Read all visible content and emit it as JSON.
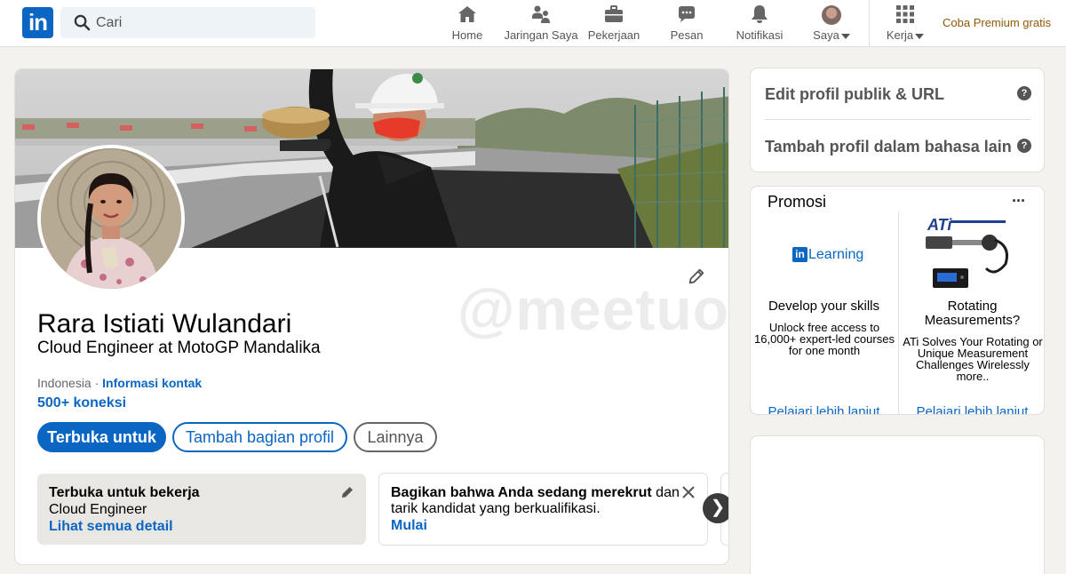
{
  "topnav": {
    "logo_text": "in",
    "search": {
      "placeholder": "Cari"
    },
    "items": [
      {
        "label": "Home",
        "icon": "home-icon"
      },
      {
        "label": "Jaringan Saya",
        "icon": "network-icon"
      },
      {
        "label": "Pekerjaan",
        "icon": "briefcase-icon"
      },
      {
        "label": "Pesan",
        "icon": "message-icon"
      },
      {
        "label": "Notifikasi",
        "icon": "bell-icon"
      },
      {
        "label": "Saya",
        "icon": "avatar"
      },
      {
        "label": "Kerja",
        "icon": "grid-icon"
      }
    ],
    "premium_label": "Coba Premium gratis"
  },
  "profile": {
    "name": "Rara Istiati Wulandari",
    "headline": "Cloud Engineer at MotoGP Mandalika",
    "location": "Indonesia",
    "separator": "·",
    "contact_link": "Informasi kontak",
    "connections": "500+ koneksi",
    "watermark": "@meetuoup",
    "buttons": {
      "open_to": "Terbuka untuk",
      "add_section": "Tambah bagian profil",
      "more": "Lainnya"
    },
    "open_to_work": {
      "title": "Terbuka untuk bekerja",
      "role": "Cloud Engineer",
      "link": "Lihat semua detail"
    },
    "share_hiring": {
      "bold_text": "Bagikan bahwa Anda sedang merekrut",
      "text": " dan tarik kandidat yang berkualifikasi.",
      "link": "Mulai"
    },
    "carousel_next": "❯"
  },
  "rightrail": {
    "edit_public_profile": "Edit profil publik & URL",
    "add_language_profile": "Tambah profil dalam bahasa lain",
    "help_glyph": "?",
    "promo": {
      "title": "Promosi",
      "more_glyph": "···",
      "items": [
        {
          "logo_text": "Learning",
          "heading": "Develop your skills",
          "desc": "Unlock free access to 16,000+ expert-led courses for one month",
          "link": "Pelajari lebih lanjut"
        },
        {
          "heading": "Rotating Measurements?",
          "desc": "ATi Solves Your Rotating or Unique Measurement Challenges Wirelessly more..",
          "link": "Pelajari lebih lanjut"
        }
      ]
    }
  },
  "colors": {
    "linkedin_blue": "#0a66c2",
    "premium_gold": "#915907",
    "background": "#f3f2ef",
    "card_border": "#e0dfdc"
  }
}
